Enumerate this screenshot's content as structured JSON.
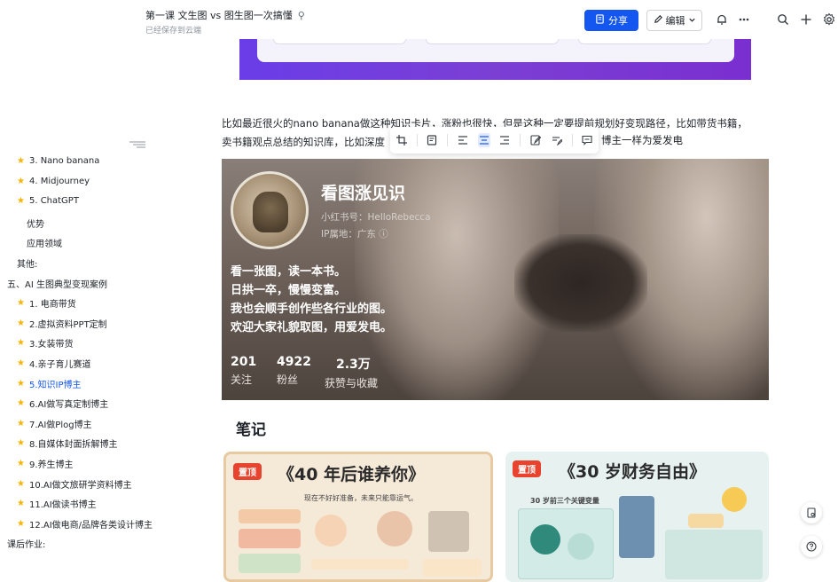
{
  "header": {
    "doc_title": "第一课 文生图 vs 图生图一次搞懂",
    "pin_glyph": "⚲",
    "saved_status": "已经保存到云端",
    "share_label": "分享",
    "edit_label": "编辑"
  },
  "sidebar": {
    "items": [
      {
        "label": "3. Nano banana",
        "star": true
      },
      {
        "label": "4. Midjourney",
        "star": true
      },
      {
        "label": "5. ChatGPT",
        "star": true
      },
      {
        "label": "优势",
        "star": false
      },
      {
        "label": "应用领域",
        "star": false
      },
      {
        "label": "其他:",
        "star": false
      },
      {
        "label": "五、AI 生图典型变现案例",
        "star": false
      },
      {
        "label": "1. 电商带货",
        "star": true
      },
      {
        "label": "2.虚拟资料PPT定制",
        "star": true
      },
      {
        "label": "3.女装带货",
        "star": true
      },
      {
        "label": "4.亲子育儿赛道",
        "star": true
      },
      {
        "label": "5.知识IP博主",
        "star": true,
        "active": true
      },
      {
        "label": "6.AI做写真定制博主",
        "star": true
      },
      {
        "label": "7.AI做Plog博主",
        "star": true
      },
      {
        "label": "8.自媒体封面拆解博主",
        "star": true
      },
      {
        "label": "9.养生博主",
        "star": true
      },
      {
        "label": "10.AI做文旅研学资料博主",
        "star": true
      },
      {
        "label": "11.AI做读书博主",
        "star": true
      },
      {
        "label": "12.AI做电商/品牌各类设计博主",
        "star": true
      },
      {
        "label": "课后作业:",
        "star": false
      }
    ]
  },
  "content": {
    "para_line1": "比如最近很火的nano banana做这种知识卡片，涨粉也很快，但是这种一定要提前规划好变现路径，比如带货书籍，",
    "para_line2_start": "卖书籍观点总结的知识库，比如深度",
    "para_line2_end": "博主一样为爱发电"
  },
  "profile": {
    "name": "看图涨见识",
    "xhs_id": "小红书号：HelloRebecca",
    "ip": "IP属地：广东 ⓘ",
    "bio": [
      "看一张图，读一本书。",
      "日拱一卒，慢慢变富。",
      "我也会顺手创作些各行业的图。",
      "欢迎大家礼貌取图，用爱发电。"
    ],
    "stats": [
      {
        "num": "201",
        "label": "关注"
      },
      {
        "num": "4922",
        "label": "粉丝"
      },
      {
        "num": "2.3万",
        "label": "获赞与收藏"
      }
    ]
  },
  "notes": {
    "title": "笔记",
    "cards": [
      {
        "badge": "置顶",
        "title": "《40 年后谁养你》",
        "subtitle": "现在不好好准备，未来只能靠运气。"
      },
      {
        "badge": "置顶",
        "title": "《30 岁财务自由》",
        "subtitle": "30 岁前三个关键变量"
      }
    ]
  },
  "colors": {
    "accent": "#1456f0",
    "star": "#f5b400",
    "badge": "#e8432f"
  }
}
